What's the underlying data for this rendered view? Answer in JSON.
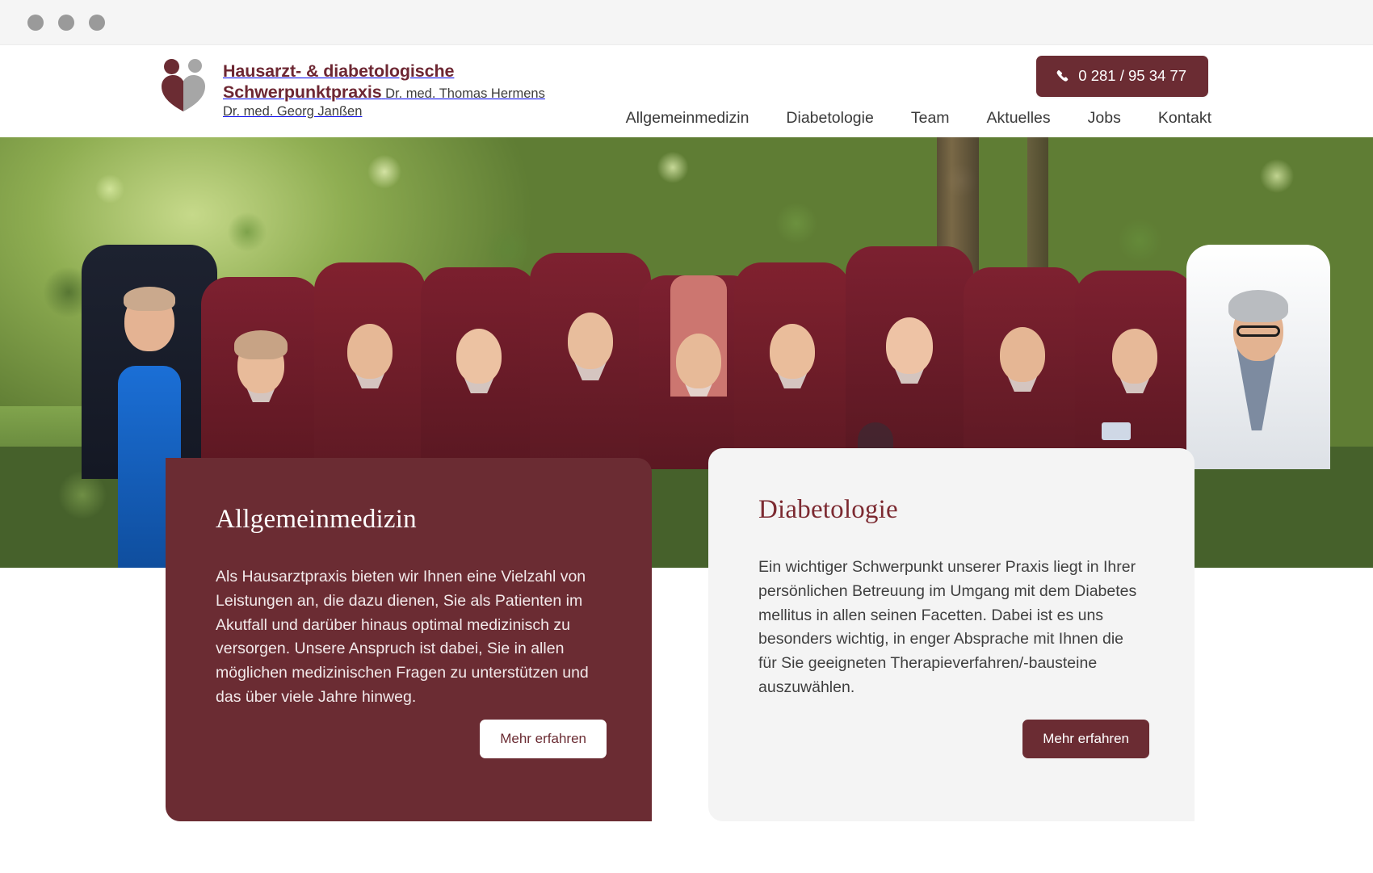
{
  "window": {
    "dots": [
      "dot-1",
      "dot-2",
      "dot-3"
    ]
  },
  "colors": {
    "brand_dark_red": "#6b2c33",
    "brand_heading_red": "#7c2a31",
    "card_light_bg": "#f4f4f4",
    "nav_text": "#3a3a3a",
    "logo_gray": "#a6a6a6"
  },
  "header": {
    "logo": {
      "icon": "two-figures-heart-logo",
      "title": "Hausarzt- & diabetologische\nSchwerpunktpraxis",
      "subtitle": "Dr. med. Thomas Hermens\nDr. med. Georg Janßen"
    },
    "phone": {
      "icon": "phone-icon",
      "number": "0 281 / 95 34 77"
    },
    "nav": [
      {
        "label": "Allgemeinmedizin"
      },
      {
        "label": "Diabetologie"
      },
      {
        "label": "Team"
      },
      {
        "label": "Aktuelles"
      },
      {
        "label": "Jobs"
      },
      {
        "label": "Kontakt"
      }
    ]
  },
  "hero": {
    "alt": "Praxisteam in weinroten Poloshirts vor Bäumen im Garten"
  },
  "cards": [
    {
      "id": "allgemeinmedizin",
      "heading": "Allgemeinmedizin",
      "body": "Als Hausarztpraxis bieten wir Ihnen eine Vielzahl von Leistungen an, die dazu dienen, Sie als Patienten im Akutfall und darüber hinaus optimal medizinisch zu versorgen. Unsere Anspruch ist dabei, Sie in allen möglichen medizinischen Fragen zu unterstützen und das über viele Jahre hinweg.",
      "button": "Mehr erfahren"
    },
    {
      "id": "diabetologie",
      "heading": "Diabetologie",
      "body": "Ein wichtiger Schwerpunkt unserer Praxis liegt in Ihrer persönlichen Betreuung im Umgang mit dem Diabetes mellitus in allen seinen Facetten. Dabei ist es uns besonders wichtig, in enger Absprache mit Ihnen die für Sie geeigneten Therapieverfahren/-bausteine auszuwählen.",
      "button": "Mehr erfahren"
    }
  ]
}
